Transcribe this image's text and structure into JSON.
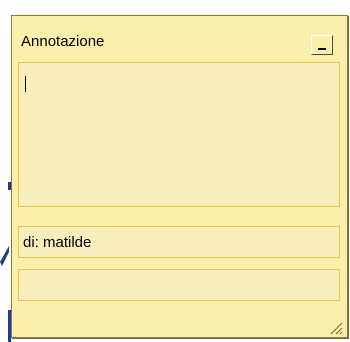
{
  "window": {
    "title": "Annotazione",
    "author_line": "di: matilde",
    "note_text": "",
    "extra_field_text": ""
  },
  "icons": {
    "minimize": "minimize-icon",
    "resize": "resize-grip-icon"
  },
  "colors": {
    "note_background": "#fbefaa",
    "field_background": "#f7eebc",
    "field_border": "#e6c84f",
    "page_mark": "#1a3a9c"
  }
}
